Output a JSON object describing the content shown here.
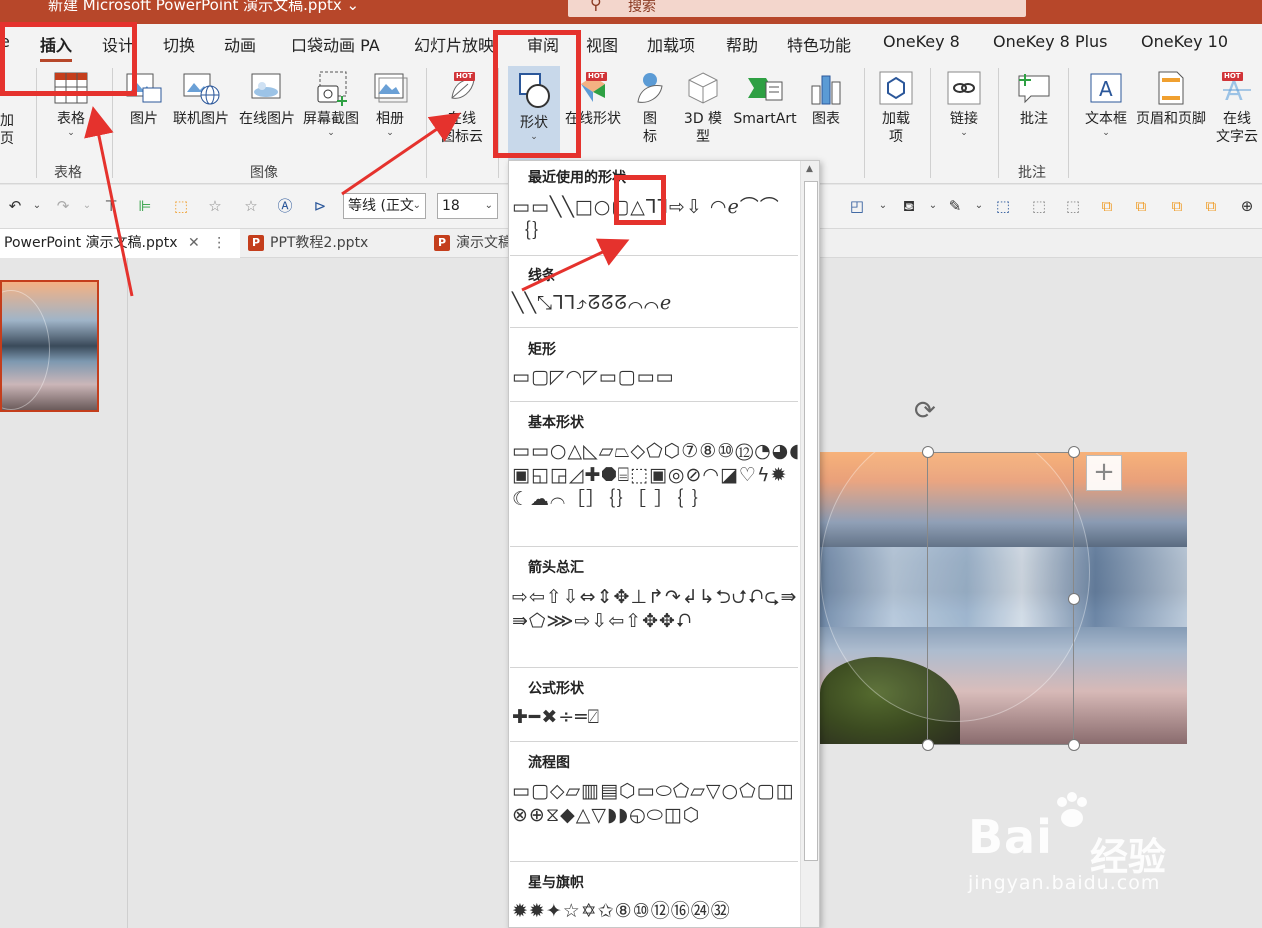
{
  "titlebar": {
    "title": "新建 Microsoft PowerPoint 演示文稿.pptx ⌄",
    "search_placeholder": "搜索"
  },
  "menu": {
    "tabs": [
      "e",
      "插入",
      "设计",
      "切换",
      "动画",
      "口袋动画 PA",
      "幻灯片放映",
      "审阅",
      "视图",
      "加载项",
      "帮助",
      "特色功能",
      "OneKey 8",
      "OneKey 8 Plus",
      "OneKey 10"
    ],
    "active_tab": "插入"
  },
  "ribbon": {
    "left_partial": [
      "加",
      "页"
    ],
    "table_label": "表格",
    "groups": {
      "table": "表格",
      "images": "图像",
      "comments": "批注"
    },
    "buttons": {
      "picture": "图片",
      "online_picture_linked": "联机图片",
      "online_picture": "在线图片",
      "screenshot": "屏幕截图",
      "album": "相册",
      "online_icon_cloud_1": "在线",
      "online_icon_cloud_2": "图标云",
      "shapes": "形状",
      "online_shapes": "在线形状",
      "icons_1": "图",
      "icons_2": "标",
      "model3d_1": "3D 模",
      "model3d_2": "型",
      "smartart": "SmartArt",
      "chart": "图表",
      "addins_1": "加载",
      "addins_2": "项",
      "link": "链接",
      "comment": "批注",
      "textbox": "文本框",
      "header_footer": "页眉和页脚",
      "online_wordcloud_1": "在线",
      "online_wordcloud_2": "文字云"
    },
    "hot_badge": "HOT"
  },
  "qat": {
    "font_name": "等线 (正文",
    "font_size": "18"
  },
  "doc_tabs": [
    {
      "label": "PowerPoint 演示文稿.pptx",
      "active": true
    },
    {
      "label": "PPT教程2.pptx",
      "active": false
    },
    {
      "label": "演示文稿",
      "active": false
    }
  ],
  "shapes_menu": {
    "sections": [
      {
        "title": "最近使用的形状",
        "glyphs": "▭▭╲╲□○▢△⅂⅂⇨⇩ ◠ℯ⌒⌒｛｝"
      },
      {
        "title": "线条",
        "glyphs": "╲╲⤡⅂⅂⤴ᘔᘔᘔ⌒⌒ℯ"
      },
      {
        "title": "矩形",
        "glyphs": "▭▢◸◠◸▭▢▭▭"
      },
      {
        "title": "基本形状",
        "glyphs": "▭▭○△◺▱⏢◇⬠⬡⑦⑧⑩⑫◔◕◖▣◱◲◿✚⯃⌸⬚▣◎⊘◠◪♡ϟ✹☾☁⌒［］｛｝［ ］｛ ｝"
      },
      {
        "title": "箭头总汇",
        "glyphs": "⇨⇦⇧⇩⇔⇕✥⊥↱↷↲↳⮌⮍⮏⮎⇛⇛⬠⋙⇨⇩⇦⇧✥✥⮏"
      },
      {
        "title": "公式形状",
        "glyphs": "✚━✖÷═⍁"
      },
      {
        "title": "流程图",
        "glyphs": "▭▢◇▱▥▤⬡▭⬭⬠▱▽○⬠▢◫⊗⊕⧖◆△▽◗◗◵⬭◫⬡"
      },
      {
        "title": "星与旗帜",
        "glyphs": "✹✹✦☆✡✩⑧⑩⑫⑯㉔㉜"
      }
    ]
  },
  "watermark": {
    "brand": "Bai",
    "brand_cn": "经验",
    "url": "jingyan.baidu.com"
  },
  "colors": {
    "accent": "#b7472a",
    "highlight": "#e5322d",
    "ribbon_bg": "#f3f3f3"
  }
}
